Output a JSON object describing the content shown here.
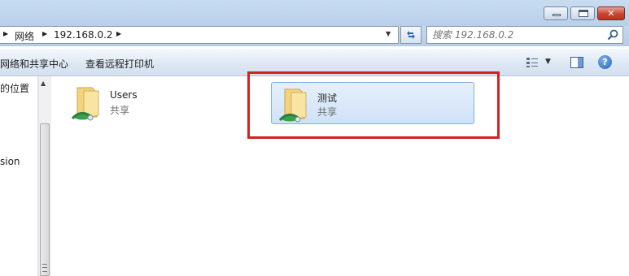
{
  "window": {
    "min_glyph": "–",
    "max_glyph": "□",
    "close_glyph": "✕"
  },
  "address": {
    "crumbs": [
      "网络",
      "192.168.0.2"
    ],
    "search_placeholder": "搜索 192.168.0.2"
  },
  "toolbar": {
    "network_sharing_center": "网络和共享中心",
    "view_remote_printers": "查看远程打印机",
    "help_label": "?"
  },
  "nav": {
    "item_locations": "的位置",
    "item_version": "sion"
  },
  "items": [
    {
      "name": "Users",
      "subtitle": "共享",
      "selected": false
    },
    {
      "name": "测试",
      "subtitle": "共享",
      "selected": true
    }
  ],
  "colors": {
    "highlight": "#d62020",
    "selection_border": "#84acdd",
    "folder": "#f3d37e"
  }
}
